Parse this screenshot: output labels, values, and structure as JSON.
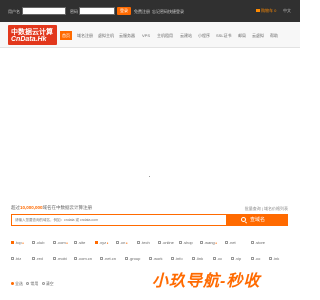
{
  "topbar": {
    "username_label": "用户名",
    "password_label": "密码",
    "login_label": "登录",
    "register_label": "免费注册",
    "forgot_label": "忘记密码",
    "quick_login_label": "快捷登录",
    "cart_label": "购物车",
    "cart_count": "0",
    "lang_label": "中文"
  },
  "header": {
    "logo_line1": "中数据云计算",
    "logo_line2": "CnData.Hk",
    "nav": [
      "首页",
      "域名注册",
      "虚拟主机",
      "云服务器",
      "VPS",
      "主机租用",
      "云建站",
      "小程序",
      "SSL证书",
      "邮局",
      "云虚拟",
      "帮助"
    ]
  },
  "search": {
    "stat_prefix": "超过",
    "stat_number": "10,000,000",
    "stat_suffix": "域名在中数据云计算注册",
    "sublinks": "批量查询 | 域名价格列表",
    "placeholder": "请输入您要查询的域名，例如：cndata 或 cndata.com",
    "button_label": "查域名"
  },
  "tlds": [
    {
      "name": ".top",
      "checked": true,
      "hot": true
    },
    {
      "name": ".club",
      "checked": false,
      "hot": false
    },
    {
      "name": ".com",
      "checked": false,
      "hot": true
    },
    {
      "name": ".site",
      "checked": false,
      "hot": false
    },
    {
      "name": ".xyz",
      "checked": true,
      "hot": true
    },
    {
      "name": ".cn",
      "checked": false,
      "hot": true
    },
    {
      "name": ".tech",
      "checked": false,
      "hot": false
    },
    {
      "name": ".online",
      "checked": false,
      "hot": false
    },
    {
      "name": ".shop",
      "checked": false,
      "hot": false
    },
    {
      "name": ".wang",
      "checked": false,
      "hot": true
    },
    {
      "name": ".net",
      "checked": false,
      "hot": false
    },
    {
      "name": ".store",
      "checked": false,
      "hot": false
    },
    {
      "name": ".biz",
      "checked": false,
      "hot": false
    },
    {
      "name": ".red",
      "checked": false,
      "hot": false
    },
    {
      "name": ".mobi",
      "checked": false,
      "hot": false
    },
    {
      "name": ".com.cn",
      "checked": false,
      "hot": false
    },
    {
      "name": ".net.cn",
      "checked": false,
      "hot": false
    },
    {
      "name": ".group",
      "checked": false,
      "hot": false
    },
    {
      "name": ".work",
      "checked": false,
      "hot": false
    },
    {
      "name": ".info",
      "checked": false,
      "hot": false
    },
    {
      "name": ".link",
      "checked": false,
      "hot": false
    },
    {
      "name": ".cc",
      "checked": false,
      "hot": false
    },
    {
      "name": ".vip",
      "checked": false,
      "hot": false
    },
    {
      "name": ".co",
      "checked": false,
      "hot": false
    },
    {
      "name": ".ink",
      "checked": false,
      "hot": false
    }
  ],
  "radio": {
    "all_label": "全选",
    "common_label": "常用",
    "clear_label": "清空"
  },
  "banner": "小玖导航-秒收",
  "colors": {
    "accent": "#ff6a00",
    "topbar": "#303030",
    "logo": "#e2371c"
  }
}
